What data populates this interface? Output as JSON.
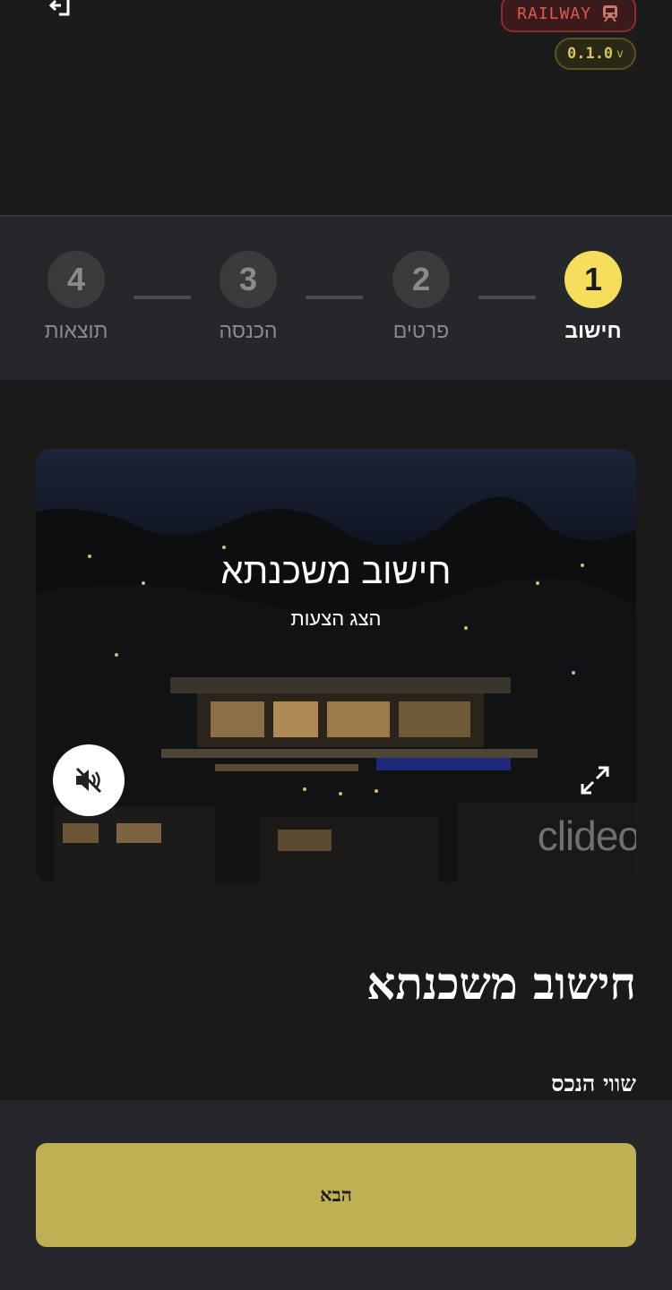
{
  "header": {
    "exit_icon": "exit-icon",
    "railway_badge": {
      "label": "RAILWAY",
      "icon": "train-icon",
      "color": "#e05a4a"
    },
    "version": {
      "value": "0.1.0",
      "suffix": "v"
    }
  },
  "stepper": {
    "steps": [
      {
        "number": "1",
        "label": "חישוב",
        "active": true
      },
      {
        "number": "2",
        "label": "פרטים",
        "active": false
      },
      {
        "number": "3",
        "label": "הכנסה",
        "active": false
      },
      {
        "number": "4",
        "label": "תוצאות",
        "active": false
      }
    ],
    "active_color": "#f4de5c"
  },
  "video": {
    "title": "חישוב משכנתא",
    "subtitle": "הצג הצעות",
    "watermark": "clideo",
    "mute_icon": "speaker-muted-icon",
    "expand_icon": "expand-icon"
  },
  "main": {
    "title": "חישוב משכנתא",
    "field_label": "שווי הנכס"
  },
  "footer": {
    "next_label": "הבא",
    "accent": "#bfb054"
  }
}
